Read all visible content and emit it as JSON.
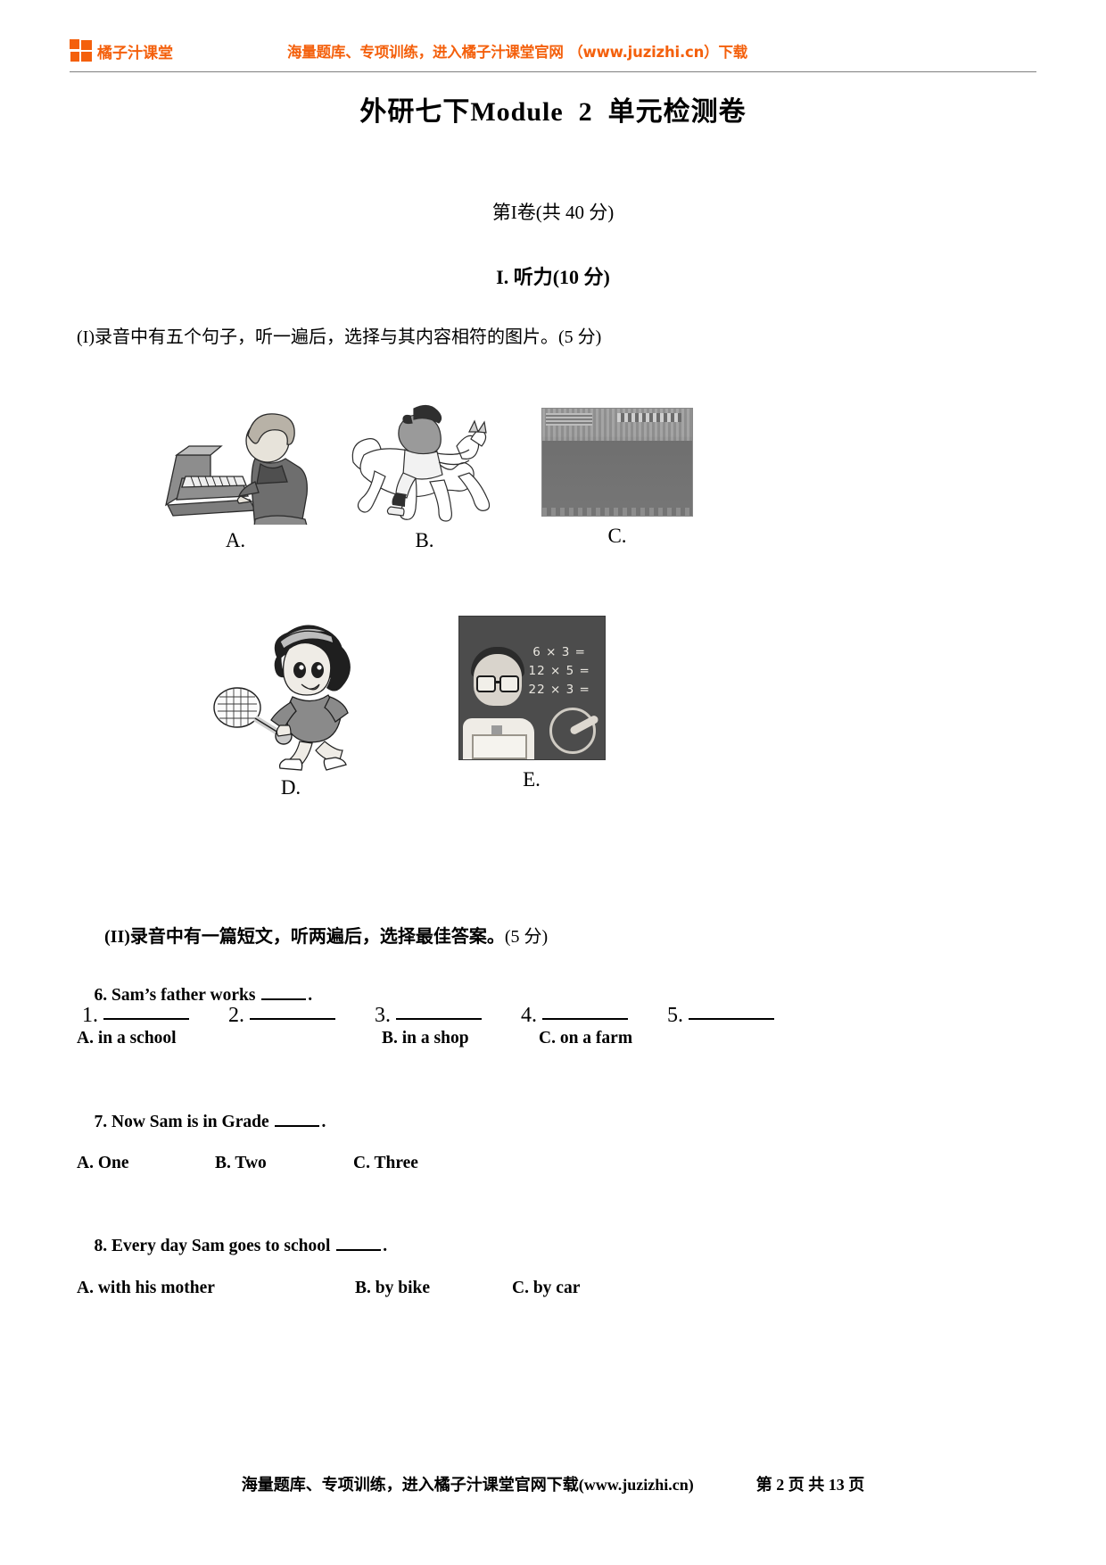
{
  "header": {
    "logo_text": "橘子汁课堂",
    "logo_icon": "four-squares-grid-icon",
    "promo": "海量题库、专项训练，进入橘子汁课堂官网 （www.juzizhi.cn）下载",
    "brand_color": "#F4600C"
  },
  "title": "外研七下Module  2  单元检测卷",
  "sections": {
    "paper_part": "第I卷(共 40 分)",
    "listening_heading": "I. 听力(10 分)"
  },
  "instructions": {
    "part_1": "(I)录音中有五个句子，听一遍后，选择与其内容相符的图片。(5 分)",
    "part_2_bold": "(II)录音中有一篇短文，听两遍后，选择最佳答案。",
    "part_2_tail": "(5 分)"
  },
  "pictures": [
    {
      "label": "A.",
      "kind": "line-art",
      "description": "girl-playing-piano-illustration"
    },
    {
      "label": "B.",
      "kind": "line-art",
      "description": "rider-on-jumping-horse-illustration"
    },
    {
      "label": "C.",
      "kind": "photo",
      "description": "football-team-group-photo"
    },
    {
      "label": "D.",
      "kind": "line-art",
      "description": "girl-playing-tennis-illustration"
    },
    {
      "label": "E.",
      "kind": "photo",
      "description": "teacher-at-blackboard-with-maths"
    }
  ],
  "blackboard_equations": "6 × 3 =\n12 × 5 =\n22 × 3 =",
  "answer_blanks": [
    {
      "num": "1."
    },
    {
      "num": "2."
    },
    {
      "num": "3."
    },
    {
      "num": "4."
    },
    {
      "num": "5."
    }
  ],
  "questions": [
    {
      "stem_before": "6. Sam’s father works ",
      "stem_after": ".",
      "options": [
        "A. in a school",
        "B. in a shop",
        "C. on a farm"
      ]
    },
    {
      "stem_before": "7. Now Sam is in Grade ",
      "stem_after": ".",
      "options": [
        "A. One",
        "B. Two",
        "C. Three"
      ]
    },
    {
      "stem_before": "8. Every day Sam goes to school ",
      "stem_after": ".",
      "options": [
        "A. with his mother",
        "B. by bike",
        "C. by car"
      ]
    }
  ],
  "footer": {
    "note": "海量题库、专项训练，进入橘子汁课堂官网下载(www.juzizhi.cn)",
    "page": "第 2 页 共 13 页"
  }
}
